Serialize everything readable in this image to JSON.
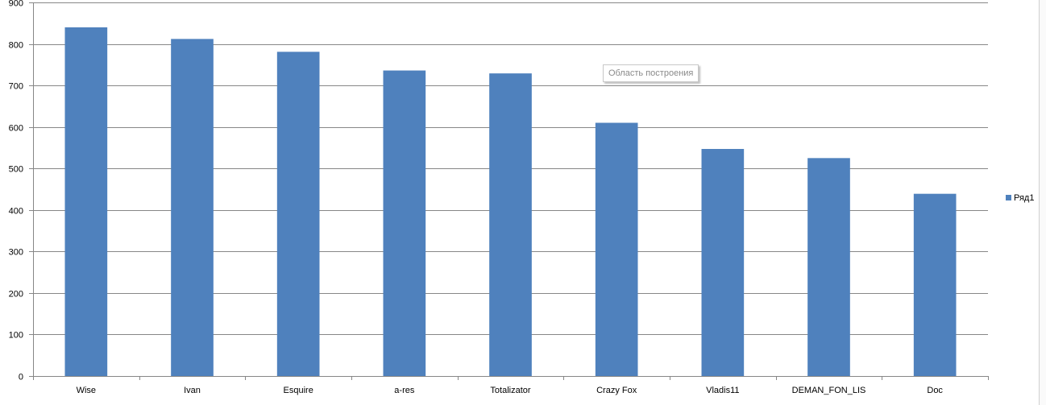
{
  "chart_data": {
    "type": "bar",
    "categories": [
      "Wise",
      "Ivan",
      "Esquire",
      "a-res",
      "Totalizator",
      "Crazy Fox",
      "Vladis11",
      "DEMAN_FON_LIS",
      "Doc"
    ],
    "series": [
      {
        "name": "Ряд1",
        "values": [
          840,
          812,
          781,
          736,
          729,
          610,
          547,
          525,
          439
        ],
        "color": "#4F81BD"
      }
    ],
    "ylim": [
      0,
      900
    ],
    "yticks": [
      "0",
      "100",
      "200",
      "300",
      "400",
      "500",
      "600",
      "700",
      "800",
      "900"
    ],
    "grid": true,
    "legend_position": "right",
    "title": "",
    "xlabel": "",
    "ylabel": ""
  },
  "tooltip": {
    "text": "Область построения"
  },
  "colors": {
    "bar": "#4F81BD",
    "grid": "#878787",
    "axis": "#878787"
  }
}
